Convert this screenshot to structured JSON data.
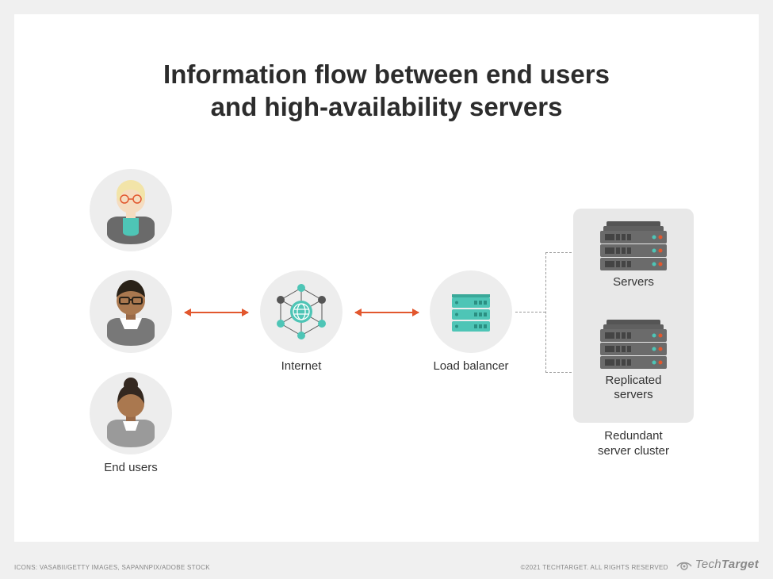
{
  "title": "Information flow between end users\nand high-availability servers",
  "labels": {
    "endUsers": "End users",
    "internet": "Internet",
    "loadBalancer": "Load balancer",
    "servers": "Servers",
    "replicatedServers": "Replicated\nservers",
    "cluster": "Redundant\nserver cluster"
  },
  "footer": {
    "credits": "ICONS: VASABII/GETTY IMAGES, SAPANNPIX/ADOBE STOCK",
    "copyright": "©2021 TECHTARGET. ALL RIGHTS RESERVED",
    "brandThin": "Tech",
    "brandBold": "Target"
  },
  "colors": {
    "teal": "#4ec5b6",
    "orange": "#e2572e",
    "gray": "#555"
  }
}
